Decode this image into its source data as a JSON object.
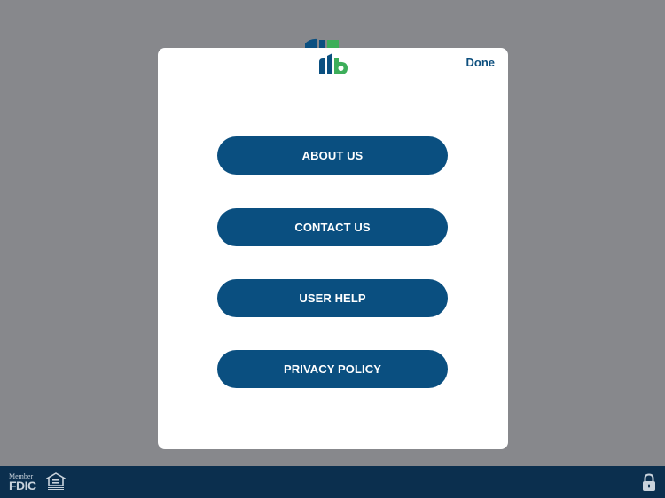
{
  "modal": {
    "done_label": "Done",
    "menu": [
      {
        "label": "ABOUT US"
      },
      {
        "label": "CONTACT US"
      },
      {
        "label": "USER HELP"
      },
      {
        "label": "PRIVACY POLICY"
      }
    ]
  },
  "footer": {
    "member_label": "Member",
    "fdic_label": "FDIC",
    "icons": [
      "equal-housing-lender-icon",
      "lock-icon"
    ]
  },
  "colors": {
    "overlay": "#87888c",
    "primary": "#0a4f80",
    "footer": "#0b2f4e",
    "logo_green": "#3dae5a"
  }
}
